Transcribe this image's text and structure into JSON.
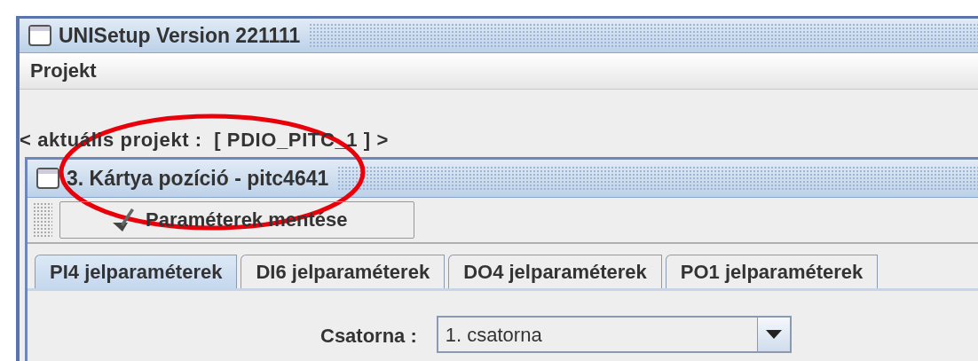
{
  "window": {
    "title": "UNISetup Version 221111"
  },
  "menu": [
    {
      "label": "Projekt"
    }
  ],
  "project_label": "< aktuális projekt :  [ PDIO_PITC_1 ] >",
  "inner_window": {
    "title": "3. Kártya pozíció - pitc4641"
  },
  "toolbar": {
    "button": "Paraméterek mentése"
  },
  "tabs": [
    {
      "label": "PI4 jelparaméterek",
      "selected": true
    },
    {
      "label": "DI6 jelparaméterek",
      "selected": false
    },
    {
      "label": "DO4 jelparaméterek",
      "selected": false
    },
    {
      "label": "PO1 jelparaméterek",
      "selected": false
    }
  ],
  "channel": {
    "label": "Csatorna :",
    "value": "1. csatorna"
  }
}
